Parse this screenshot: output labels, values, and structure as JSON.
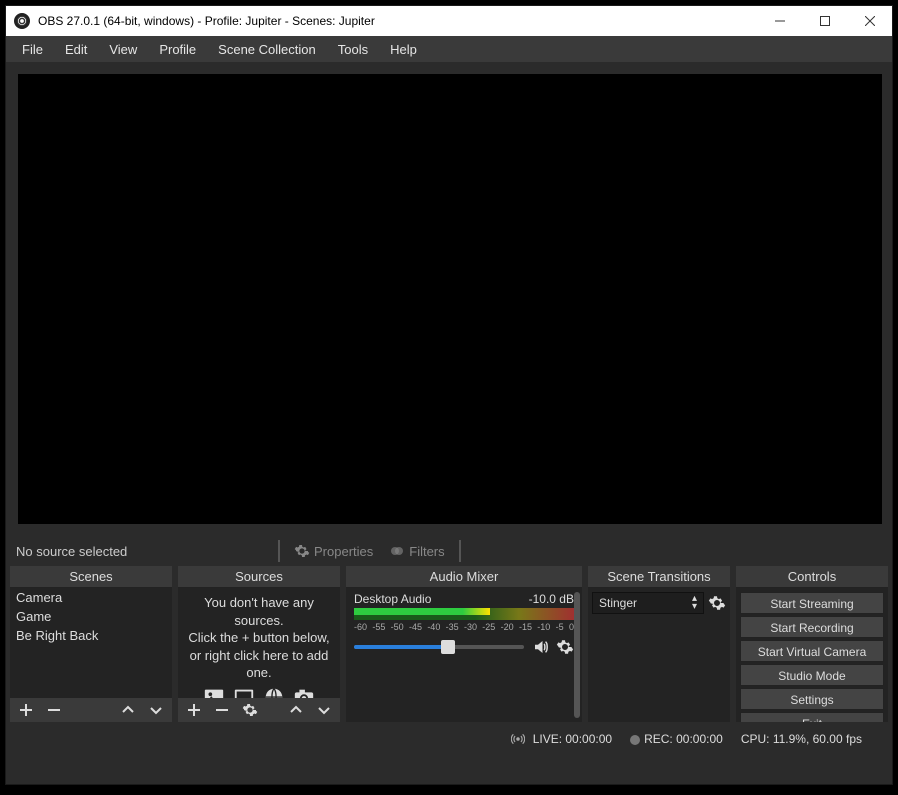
{
  "window": {
    "title": "OBS 27.0.1 (64-bit, windows) - Profile: Jupiter - Scenes: Jupiter"
  },
  "menu": [
    "File",
    "Edit",
    "View",
    "Profile",
    "Scene Collection",
    "Tools",
    "Help"
  ],
  "toolbar": {
    "status": "No source selected",
    "properties": "Properties",
    "filters": "Filters"
  },
  "panels": {
    "scenes": {
      "title": "Scenes",
      "items": [
        "Camera",
        "Game",
        "Be Right Back"
      ]
    },
    "sources": {
      "title": "Sources",
      "empty_line1": "You don't have any sources.",
      "empty_line2": "Click the + button below,",
      "empty_line3": "or right click here to add one."
    },
    "mixer": {
      "title": "Audio Mixer",
      "track_name": "Desktop Audio",
      "track_db": "-10.0 dB",
      "ticks": [
        "-60",
        "-55",
        "-50",
        "-45",
        "-40",
        "-35",
        "-30",
        "-25",
        "-20",
        "-15",
        "-10",
        "-5",
        "0"
      ]
    },
    "transitions": {
      "title": "Scene Transitions",
      "selected": "Stinger"
    },
    "controls": {
      "title": "Controls",
      "buttons": [
        "Start Streaming",
        "Start Recording",
        "Start Virtual Camera",
        "Studio Mode",
        "Settings",
        "Exit"
      ]
    }
  },
  "status": {
    "live": "LIVE: 00:00:00",
    "rec": "REC: 00:00:00",
    "cpu": "CPU: 11.9%, 60.00 fps"
  }
}
